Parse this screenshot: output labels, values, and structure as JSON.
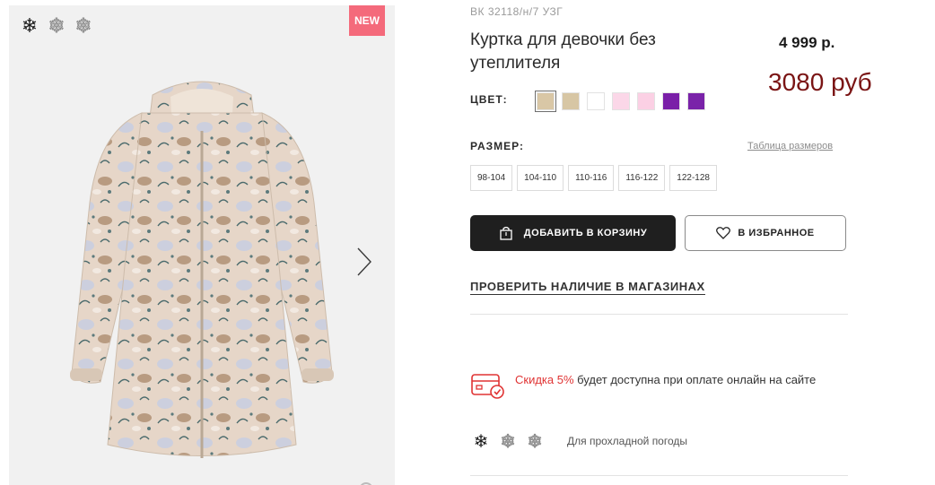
{
  "gallery": {
    "badge": "NEW",
    "season_icons": [
      {
        "icon": "snowflake-icon",
        "active": true
      },
      {
        "icon": "snowflake-icon",
        "active": false
      },
      {
        "icon": "snowflake-icon",
        "active": false
      }
    ],
    "next_icon": "chevron-right-icon"
  },
  "product": {
    "sku": "ВК 32118/н/7 УЗГ",
    "title": "Куртка для девочки без утеплителя",
    "price": "4 999 р.",
    "price_alt": "3080 руб"
  },
  "color": {
    "label": "ЦВЕТ:",
    "swatches": [
      "#d9c7a6",
      "#d7c6a4",
      "#ffffff",
      "#fbd7e8",
      "#fbd0e4",
      "#7a1fa8",
      "#7a23a9"
    ],
    "selected_index": 0
  },
  "size": {
    "label": "РАЗМЕР:",
    "chart_link": "Таблица размеров",
    "options": [
      "98-104",
      "104-110",
      "110-116",
      "116-122",
      "122-128"
    ]
  },
  "actions": {
    "cart_label": "ДОБАВИТЬ В КОРЗИНУ",
    "fav_label": "В ИЗБРАННОЕ",
    "check_label": "ПРОВЕРИТЬ НАЛИЧИЕ В МАГАЗИНАХ"
  },
  "promo": {
    "accent": "Скидка 5%",
    "text": " будет доступна при оплате онлайн на сайте",
    "accent_color": "#e03434"
  },
  "weather": {
    "text": "Для прохладной погоды",
    "icons": [
      {
        "icon": "snowflake-icon",
        "active": true
      },
      {
        "icon": "snowflake-icon",
        "active": false
      },
      {
        "icon": "snowflake-icon",
        "active": false
      }
    ]
  }
}
